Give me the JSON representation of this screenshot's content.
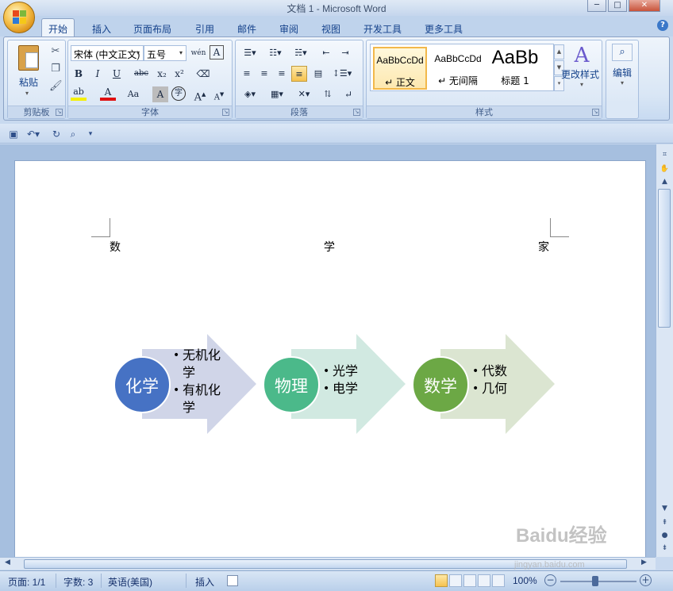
{
  "window": {
    "title": "文档 1 - Microsoft Word",
    "controls": {
      "minimize": "─",
      "maximize": "□",
      "close": "✕"
    }
  },
  "ribbon_tabs": [
    "开始",
    "插入",
    "页面布局",
    "引用",
    "邮件",
    "审阅",
    "视图",
    "开发工具",
    "更多工具"
  ],
  "active_tab": "开始",
  "help": "?",
  "clipboard": {
    "paste_label": "粘贴",
    "group_label": "剪贴板"
  },
  "font": {
    "family_value": "宋体 (中文正文)",
    "size_value": "五号",
    "group_label": "字体",
    "buttons": {
      "bold": "B",
      "italic": "I",
      "underline": "U",
      "strike": "abc",
      "subscript": "x₂",
      "superscript": "x²",
      "grow": "A",
      "shrink": "A",
      "change_case": "Aa",
      "highlight": "ab",
      "font_color": "A",
      "char_shading": "A",
      "enclose": "字",
      "phonetic": "wén",
      "clear": "A"
    }
  },
  "paragraph": {
    "group_label": "段落"
  },
  "styles": {
    "group_label": "样式",
    "items": [
      {
        "sample": "AaBbCcDd",
        "name": "↵ 正文"
      },
      {
        "sample": "AaBbCcDd",
        "name": "↵ 无间隔"
      },
      {
        "sample": "AaBb",
        "name": "标题 1"
      }
    ],
    "change_label": "更改样式"
  },
  "editing": {
    "label": "编辑"
  },
  "document": {
    "header_chars": [
      "数",
      "学",
      "家"
    ],
    "smartart": [
      {
        "title": "化学",
        "items": [
          "无机化学",
          "有机化学"
        ],
        "circle_color": "#4672c4",
        "arrow_color": "#d0d5e8"
      },
      {
        "title": "物理",
        "items": [
          "光学",
          "电学"
        ],
        "circle_color": "#4bb98a",
        "arrow_color": "#d1e9e1"
      },
      {
        "title": "数学",
        "items": [
          "代数",
          "几何"
        ],
        "circle_color": "#6ca845",
        "arrow_color": "#dbe5d1"
      }
    ]
  },
  "status": {
    "page": "页面: 1/1",
    "words": "字数: 3",
    "language": "英语(美国)",
    "mode": "插入",
    "zoom": "100%"
  },
  "watermark": {
    "text": "Baidu经验",
    "url": "jingyan.baidu.com"
  }
}
